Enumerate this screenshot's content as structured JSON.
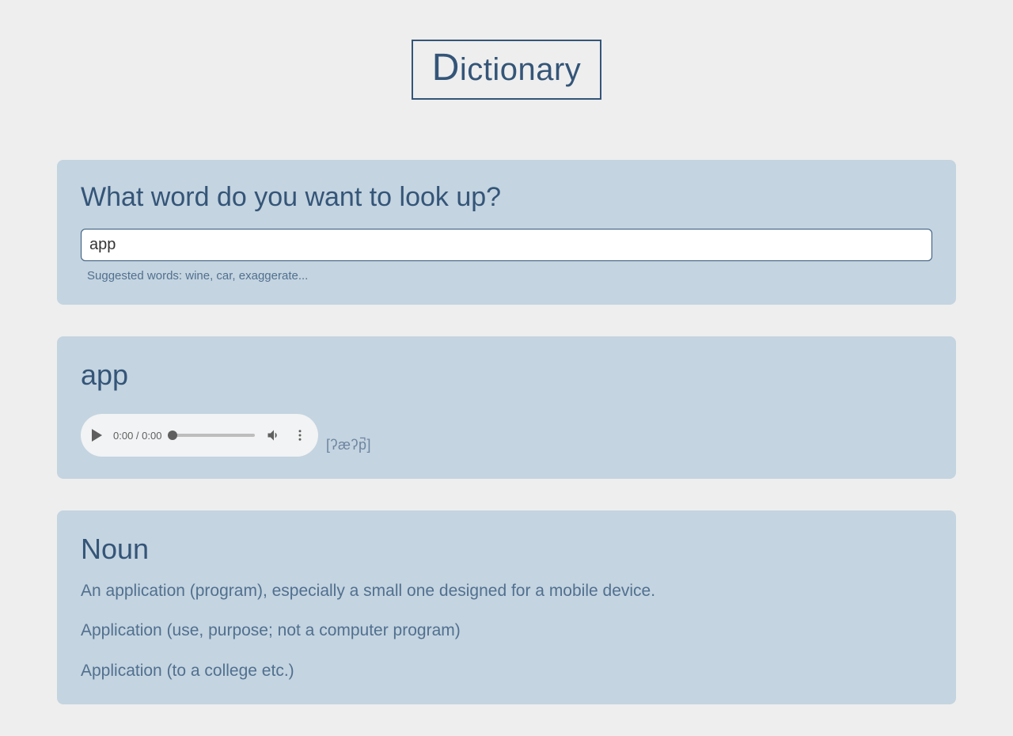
{
  "logo": {
    "first_letter": "D",
    "rest": "ictionary"
  },
  "search": {
    "heading": "What word do you want to look up?",
    "value": "app",
    "suggested": "Suggested words: wine, car, exaggerate..."
  },
  "entry": {
    "word": "app",
    "audio_time": "0:00 / 0:00",
    "ipa": "[ʔæʔp̚]"
  },
  "pos": {
    "label": "Noun",
    "definitions": [
      "An application (program), especially a small one designed for a mobile device.",
      "Application (use, purpose; not a computer program)",
      "Application (to a college etc.)"
    ]
  }
}
